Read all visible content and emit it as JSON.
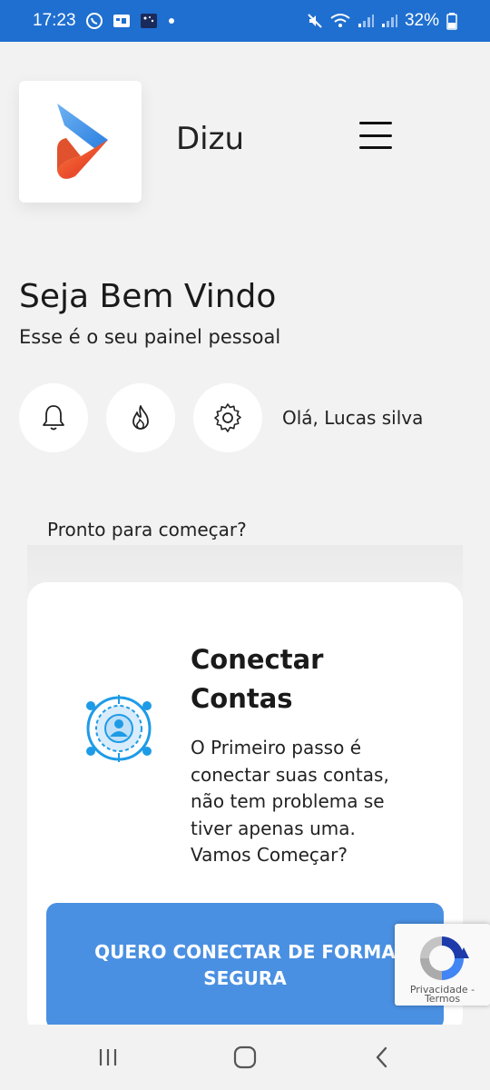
{
  "status_bar": {
    "time": "17:23",
    "battery": "32%",
    "left_icons": [
      "whatsapp-icon",
      "keyboard-icon",
      "app-icon",
      "dot-icon"
    ],
    "right_icons": [
      "mute-icon",
      "wifi-icon",
      "signal-icon",
      "signal-icon",
      "battery-icon"
    ]
  },
  "header": {
    "app_name": "Dizu",
    "logo": "dizu-logo",
    "menu_icon": "hamburger-menu-icon"
  },
  "welcome": {
    "title": "Seja Bem Vindo",
    "subtitle": "Esse é o seu painel pessoal"
  },
  "quick_actions": [
    {
      "icon": "bell-icon"
    },
    {
      "icon": "fire-icon"
    },
    {
      "icon": "gear-icon"
    }
  ],
  "greeting": "Olá, Lucas silva",
  "ready_label": "Pronto para começar?",
  "card": {
    "title_line1": "Conectar",
    "title_line2": "Contas",
    "text_lines": [
      "O Primeiro passo é",
      "conectar suas contas,",
      "não tem problema se",
      "tiver apenas uma.",
      "Vamos Começar?"
    ],
    "icon": "connect-accounts-icon"
  },
  "cta": {
    "line1": "QUERO CONECTAR DE FORMA",
    "line2": "SEGURA"
  },
  "recaptcha": {
    "line1": "Privacidade -",
    "line2": "Termos"
  },
  "nav_bar": {
    "icons": [
      "recent-apps-icon",
      "home-icon",
      "back-icon"
    ]
  },
  "colors": {
    "status_bar": "#1f6fd0",
    "accent": "#4a90e2",
    "background": "#f2f2f2"
  }
}
